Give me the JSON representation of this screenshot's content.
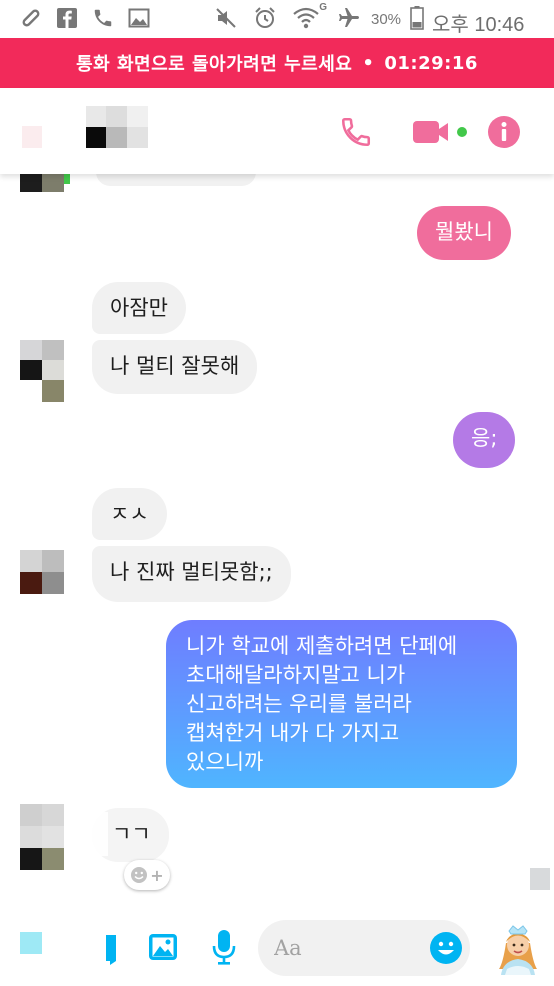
{
  "status_bar": {
    "icons": [
      "link-icon",
      "facebook-icon",
      "phone-icon",
      "image-icon",
      "mute-icon",
      "alarm-icon",
      "wifi-icon",
      "airplane-icon",
      "battery-icon"
    ],
    "wifi_label": "G",
    "battery_percent": "30%",
    "time_label": "오후 10:46"
  },
  "call_banner": {
    "text": "통화 화면으로 돌아가려면 누르세요",
    "separator": "•",
    "timer": "01:29:16"
  },
  "header": {
    "actions": [
      "phone-icon",
      "video-camera-icon",
      "info-icon"
    ]
  },
  "messages": [
    {
      "side": "out",
      "text": "뭘봤니"
    },
    {
      "side": "in",
      "text": "아잠만"
    },
    {
      "side": "in",
      "text": "나 멀티 잘못해"
    },
    {
      "side": "out",
      "text": "응;"
    },
    {
      "side": "in",
      "text": "ㅈㅅ"
    },
    {
      "side": "in",
      "text": "나 진짜 멀티못함;;"
    },
    {
      "side": "out",
      "lines": [
        "니가 학교에 제출하려면 단페에",
        "초대해달라하지말고 니가",
        "신고하려는 우리를 불러라",
        "캡쳐한거 내가 다 가지고",
        "있으니까"
      ]
    },
    {
      "side": "in",
      "text": "ㄱㄱ"
    }
  ],
  "reaction_button": {
    "icon": "smiley-add-icon",
    "label": "+"
  },
  "composer": {
    "placeholder": "Aa",
    "icons": [
      "menu-icon",
      "sticker-icon",
      "gallery-icon",
      "microphone-icon",
      "emoji-icon",
      "bitmoji-avatar-icon"
    ]
  },
  "colors": {
    "banner": "#f22a5a",
    "accent_pink": "#f06d9c",
    "accent_purple": "#b47ae6",
    "gradient_top": "#6f7dff",
    "gradient_bottom": "#4fb5ff",
    "incoming_bubble": "#f1f1f1"
  }
}
